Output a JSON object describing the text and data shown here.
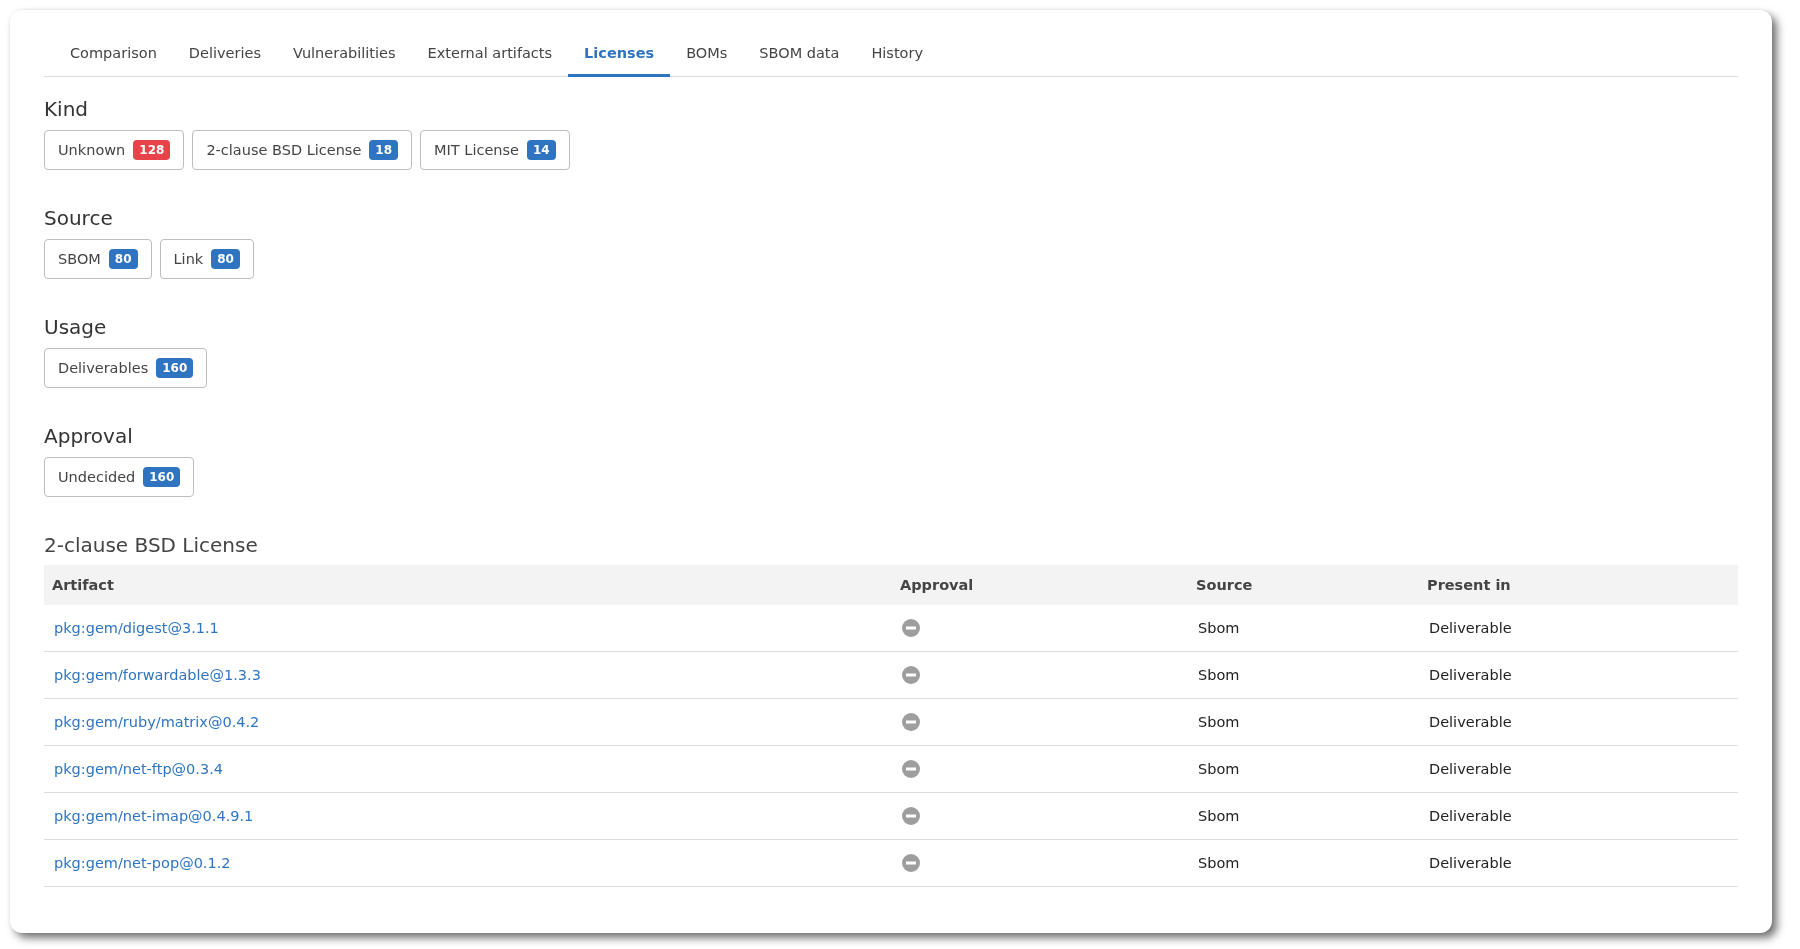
{
  "tabs": [
    {
      "label": "Comparison",
      "selected": false
    },
    {
      "label": "Deliveries",
      "selected": false
    },
    {
      "label": "Vulnerabilities",
      "selected": false
    },
    {
      "label": "External artifacts",
      "selected": false
    },
    {
      "label": "Licenses",
      "selected": true
    },
    {
      "label": "BOMs",
      "selected": false
    },
    {
      "label": "SBOM data",
      "selected": false
    },
    {
      "label": "History",
      "selected": false
    }
  ],
  "filter_groups": [
    {
      "title": "Kind",
      "filters": [
        {
          "label": "Unknown",
          "count": "128",
          "color": "#e8434a"
        },
        {
          "label": "2-clause BSD License",
          "count": "18",
          "color": "#2f74c0"
        },
        {
          "label": "MIT License",
          "count": "14",
          "color": "#2f74c0"
        }
      ]
    },
    {
      "title": "Source",
      "filters": [
        {
          "label": "SBOM",
          "count": "80",
          "color": "#2f74c0"
        },
        {
          "label": "Link",
          "count": "80",
          "color": "#2f74c0"
        }
      ]
    },
    {
      "title": "Usage",
      "filters": [
        {
          "label": "Deliverables",
          "count": "160",
          "color": "#2f74c0"
        }
      ]
    },
    {
      "title": "Approval",
      "filters": [
        {
          "label": "Undecided",
          "count": "160",
          "color": "#2f74c0"
        }
      ]
    }
  ],
  "table": {
    "title": "2-clause BSD License",
    "columns": [
      "Artifact",
      "Approval",
      "Source",
      "Present in"
    ],
    "rows": [
      {
        "artifact": "pkg:gem/digest@3.1.1",
        "kind": "undecided",
        "source": "Sbom",
        "present_in": "Deliverable"
      },
      {
        "artifact": "pkg:gem/forwardable@1.3.3",
        "kind": "undecided",
        "source": "Sbom",
        "present_in": "Deliverable"
      },
      {
        "artifact": "pkg:gem/ruby/matrix@0.4.2",
        "kind": "undecided",
        "source": "Sbom",
        "present_in": "Deliverable"
      },
      {
        "artifact": "pkg:gem/net-ftp@0.3.4",
        "kind": "undecided",
        "source": "Sbom",
        "present_in": "Deliverable"
      },
      {
        "artifact": "pkg:gem/net-imap@0.4.9.1",
        "kind": "undecided",
        "source": "Sbom",
        "present_in": "Deliverable"
      },
      {
        "artifact": "pkg:gem/net-pop@0.1.2",
        "kind": "undecided",
        "source": "Sbom",
        "present_in": "Deliverable"
      }
    ]
  }
}
